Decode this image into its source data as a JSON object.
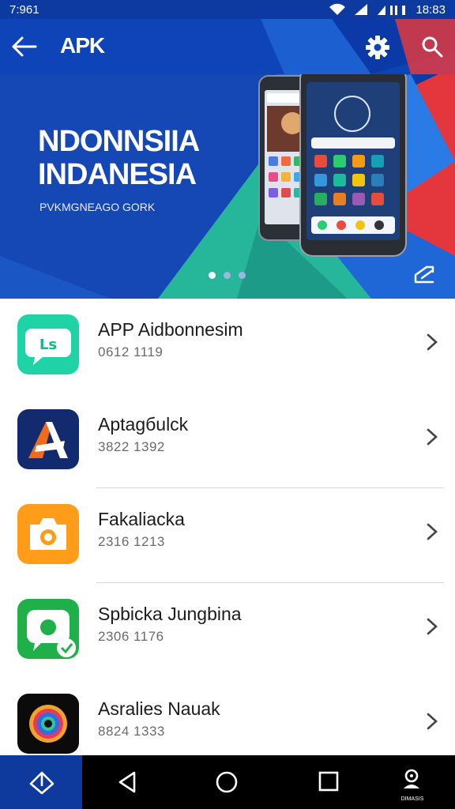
{
  "status_bar": {
    "left_time": "7:961",
    "right_time": "18:83"
  },
  "app_bar": {
    "title": "APK"
  },
  "banner": {
    "title_line1": "NDONNSIIA",
    "title_line2": "INDANESIA",
    "subtitle": "PVKMGNEAGO GORK",
    "slide_count": 3,
    "active_slide": 1
  },
  "apps": [
    {
      "name": "APP Aidbonnesim",
      "sub": "0612 1119",
      "icon": "chat-bubble-icon",
      "color": "#1fd3a7"
    },
    {
      "name": "Aptagбulck",
      "sub": "3822 1392",
      "icon": "arrow-a-icon",
      "color": "#122a6e"
    },
    {
      "name": "Fakaliacka",
      "sub": "2316 1213",
      "icon": "camera-icon",
      "color": "#ff9d1a"
    },
    {
      "name": "Spbicka Jungbina",
      "sub": "2306 1176",
      "icon": "chat-check-icon",
      "color": "#1fb04a"
    },
    {
      "name": "Asralies Nauak",
      "sub": "8824 1333",
      "icon": "lens-icon",
      "color": "#0b0b0b"
    }
  ],
  "nav_bar": {
    "profile_label": "DIMASIS"
  }
}
